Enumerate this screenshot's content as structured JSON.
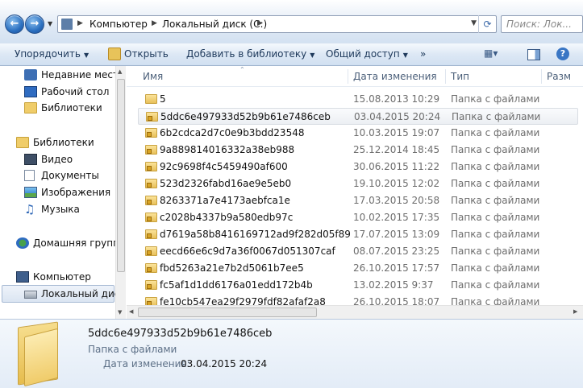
{
  "address": {
    "segments": [
      "Компьютер",
      "Локальный диск (C:)"
    ],
    "search_placeholder": "Поиск: Лок..."
  },
  "toolbar": {
    "organize": "Упорядочить",
    "open": "Открыть",
    "add_library": "Добавить в библиотеку",
    "share": "Общий доступ",
    "more": "»"
  },
  "nav": {
    "items": [
      {
        "label": "Недавние места",
        "icon": "recent-places-icon"
      },
      {
        "label": "Рабочий стол",
        "icon": "desktop-icon"
      },
      {
        "label": "Библиотеки",
        "icon": "libraries-icon"
      },
      {
        "label": "Библиотеки",
        "icon": "libraries-icon"
      },
      {
        "label": "Видео",
        "icon": "video-icon"
      },
      {
        "label": "Документы",
        "icon": "documents-icon"
      },
      {
        "label": "Изображения",
        "icon": "pictures-icon"
      },
      {
        "label": "Музыка",
        "icon": "music-icon"
      },
      {
        "label": "Домашняя группа",
        "icon": "homegroup-icon"
      },
      {
        "label": "Компьютер",
        "icon": "computer-icon"
      },
      {
        "label": "Локальный диск",
        "icon": "drive-icon"
      }
    ]
  },
  "columns": {
    "name": "Имя",
    "date": "Дата изменения",
    "type": "Тип",
    "size": "Разм"
  },
  "files": [
    {
      "name": "5",
      "date": "15.08.2013 10:29",
      "type": "Папка с файлами"
    },
    {
      "name": "5ddc6e497933d52b9b61e7486ceb",
      "date": "03.04.2015 20:24",
      "type": "Папка с файлами"
    },
    {
      "name": "6b2cdca2d7c0e9b3bdd23548",
      "date": "10.03.2015 19:07",
      "type": "Папка с файлами"
    },
    {
      "name": "9a889814016332a38eb988",
      "date": "25.12.2014 18:45",
      "type": "Папка с файлами"
    },
    {
      "name": "92c9698f4c5459490af600",
      "date": "30.06.2015 11:22",
      "type": "Папка с файлами"
    },
    {
      "name": "523d2326fabd16ae9e5eb0",
      "date": "19.10.2015 12:02",
      "type": "Папка с файлами"
    },
    {
      "name": "8263371a7e4173aebfca1e",
      "date": "17.03.2015 20:58",
      "type": "Папка с файлами"
    },
    {
      "name": "c2028b4337b9a580edb97c",
      "date": "10.02.2015 17:35",
      "type": "Папка с файлами"
    },
    {
      "name": "d7619a58b8416169712ad9f282d05f89",
      "date": "17.07.2015 13:09",
      "type": "Папка с файлами"
    },
    {
      "name": "eecd66e6c9d7a36f0067d051307caf",
      "date": "08.07.2015 23:25",
      "type": "Папка с файлами"
    },
    {
      "name": "fbd5263a21e7b2d5061b7ee5",
      "date": "26.10.2015 17:57",
      "type": "Папка с файлами"
    },
    {
      "name": "fc5af1d1dd6176a01edd172b4b",
      "date": "13.02.2015 9:37",
      "type": "Папка с файлами"
    },
    {
      "name": "fe10cb547ea29f2979fdf82afaf2a8",
      "date": "26.10.2015 18:07",
      "type": "Папка с файлами"
    }
  ],
  "details": {
    "name": "5ddc6e497933d52b9b61e7486ceb",
    "type": "Папка с файлами",
    "date_label": "Дата изменения:",
    "date": "03.04.2015 20:24"
  }
}
